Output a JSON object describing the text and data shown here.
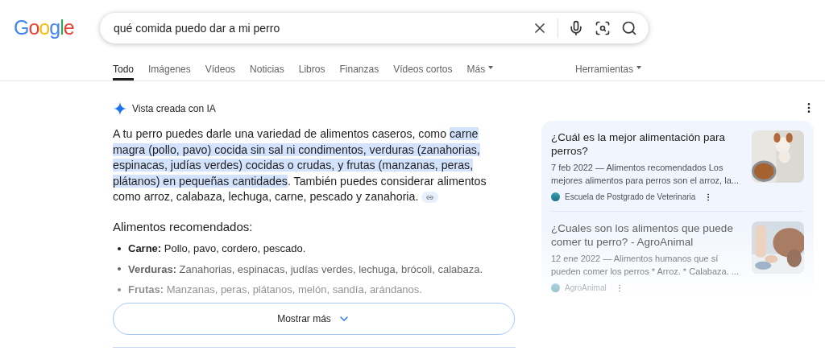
{
  "logo": "Google",
  "search": {
    "value": "qué comida puedo dar a mi perro"
  },
  "tabs": [
    {
      "label": "Todo",
      "selected": true
    },
    {
      "label": "Imágenes",
      "selected": false
    },
    {
      "label": "Vídeos",
      "selected": false
    },
    {
      "label": "Noticias",
      "selected": false
    },
    {
      "label": "Libros",
      "selected": false
    },
    {
      "label": "Finanzas",
      "selected": false
    },
    {
      "label": "Vídeos cortos",
      "selected": false
    },
    {
      "label": "Más",
      "selected": false
    }
  ],
  "tools": "Herramientas",
  "ai_overview": {
    "label": "Vista creada con IA",
    "paragraph": [
      {
        "text": "A tu perro puedes darle una variedad de alimentos caseros, como ",
        "highlighted": false
      },
      {
        "text": "carne magra (pollo, pavo) cocida sin sal ni condimentos, verduras (zanahorias, espinacas, judías verdes) cocidas o crudas, y frutas (manzanas, peras, plátanos) en pequeñas cantidades",
        "highlighted": true
      },
      {
        "text": ". También puedes considerar alimentos como arroz, calabaza, lechuga, carne, pescado y zanahoria.",
        "highlighted": false
      }
    ],
    "list_title": "Alimentos recomendados:",
    "items": [
      {
        "term": "Carne:",
        "text": "Pollo, pavo, cordero, pescado."
      },
      {
        "term": "Verduras:",
        "text": "Zanahorias, espinacas, judías verdes, lechuga, brócoli, calabaza."
      },
      {
        "term": "Frutas:",
        "text": "Manzanas, peras, plátanos, melón, sandía, arándanos."
      }
    ],
    "show_more": "Mostrar más"
  },
  "sources": [
    {
      "title": "¿Cuál es la mejor alimentación para perros?",
      "snippet": "7 feb 2022 — Alimentos recomendados Los mejores alimentos para perros son el arroz, la...",
      "site": "Escuela de Postgrado de Veterinaria",
      "kind": "picture"
    },
    {
      "title": "¿Cuales son los alimentos que puede comer tu perro? - AgroAnimal",
      "snippet": "12 ene 2022 — Alimentos humanos que sí pueden comer los perros * Arroz. * Calabaza. ...",
      "site": "AgroAnimal",
      "kind": "picture"
    }
  ]
}
